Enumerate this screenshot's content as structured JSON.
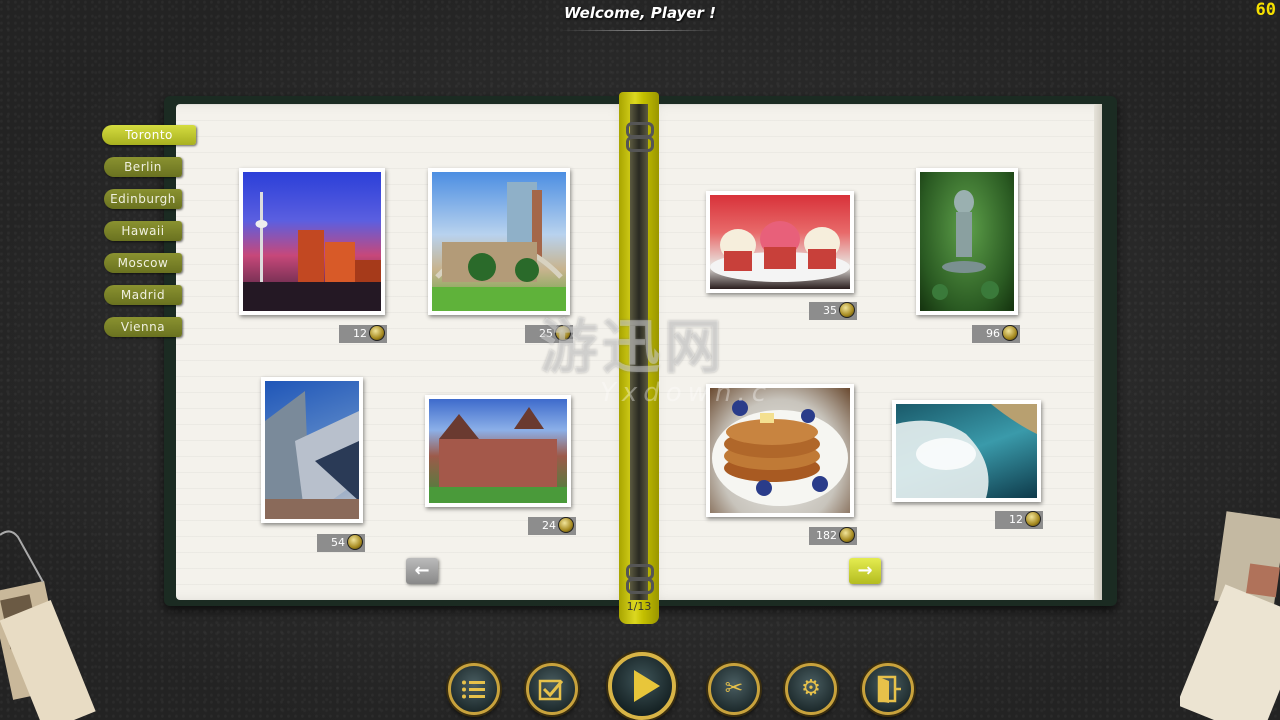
{
  "header": {
    "welcome": "Welcome, Player !",
    "fps": "60"
  },
  "tabs": [
    {
      "label": "Toronto",
      "active": true
    },
    {
      "label": "Berlin"
    },
    {
      "label": "Edinburgh"
    },
    {
      "label": "Hawaii"
    },
    {
      "label": "Moscow"
    },
    {
      "label": "Madrid"
    },
    {
      "label": "Vienna"
    }
  ],
  "puzzles": [
    {
      "pieces": "12",
      "subject": "cn-tower-night"
    },
    {
      "pieces": "25",
      "subject": "city-hall"
    },
    {
      "pieces": "54",
      "subject": "royal-ontario-museum"
    },
    {
      "pieces": "24",
      "subject": "victorian-building"
    },
    {
      "pieces": "35",
      "subject": "maple-cupcakes"
    },
    {
      "pieces": "96",
      "subject": "garden-fountain"
    },
    {
      "pieces": "182",
      "subject": "pancakes-syrup"
    },
    {
      "pieces": "12",
      "subject": "waterfall"
    }
  ],
  "pagination": {
    "label": "1/13"
  },
  "watermark": {
    "line1": "游迅网",
    "line2": "Yxdown.c"
  },
  "toolbar": {
    "buttons": [
      {
        "icon": "list-stars-icon"
      },
      {
        "icon": "checkbox-icon"
      },
      {
        "icon": "play-icon"
      },
      {
        "icon": "scissors-icon"
      },
      {
        "icon": "gear-icon"
      },
      {
        "icon": "exit-door-icon"
      }
    ]
  },
  "colors": {
    "accent": "#d4dc40",
    "fps": "#f5e000",
    "ring": "#c8a23c"
  }
}
